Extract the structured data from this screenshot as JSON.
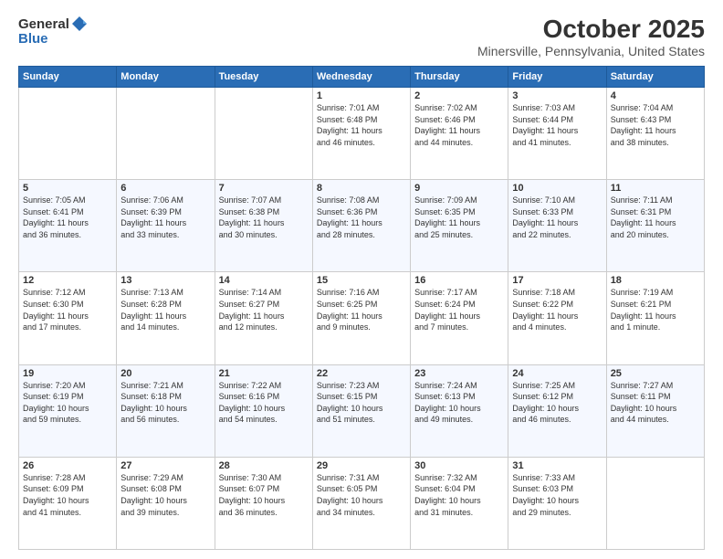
{
  "header": {
    "logo_general": "General",
    "logo_blue": "Blue",
    "title": "October 2025",
    "subtitle": "Minersville, Pennsylvania, United States"
  },
  "days_of_week": [
    "Sunday",
    "Monday",
    "Tuesday",
    "Wednesday",
    "Thursday",
    "Friday",
    "Saturday"
  ],
  "weeks": [
    [
      {
        "day": "",
        "info": ""
      },
      {
        "day": "",
        "info": ""
      },
      {
        "day": "",
        "info": ""
      },
      {
        "day": "1",
        "info": "Sunrise: 7:01 AM\nSunset: 6:48 PM\nDaylight: 11 hours\nand 46 minutes."
      },
      {
        "day": "2",
        "info": "Sunrise: 7:02 AM\nSunset: 6:46 PM\nDaylight: 11 hours\nand 44 minutes."
      },
      {
        "day": "3",
        "info": "Sunrise: 7:03 AM\nSunset: 6:44 PM\nDaylight: 11 hours\nand 41 minutes."
      },
      {
        "day": "4",
        "info": "Sunrise: 7:04 AM\nSunset: 6:43 PM\nDaylight: 11 hours\nand 38 minutes."
      }
    ],
    [
      {
        "day": "5",
        "info": "Sunrise: 7:05 AM\nSunset: 6:41 PM\nDaylight: 11 hours\nand 36 minutes."
      },
      {
        "day": "6",
        "info": "Sunrise: 7:06 AM\nSunset: 6:39 PM\nDaylight: 11 hours\nand 33 minutes."
      },
      {
        "day": "7",
        "info": "Sunrise: 7:07 AM\nSunset: 6:38 PM\nDaylight: 11 hours\nand 30 minutes."
      },
      {
        "day": "8",
        "info": "Sunrise: 7:08 AM\nSunset: 6:36 PM\nDaylight: 11 hours\nand 28 minutes."
      },
      {
        "day": "9",
        "info": "Sunrise: 7:09 AM\nSunset: 6:35 PM\nDaylight: 11 hours\nand 25 minutes."
      },
      {
        "day": "10",
        "info": "Sunrise: 7:10 AM\nSunset: 6:33 PM\nDaylight: 11 hours\nand 22 minutes."
      },
      {
        "day": "11",
        "info": "Sunrise: 7:11 AM\nSunset: 6:31 PM\nDaylight: 11 hours\nand 20 minutes."
      }
    ],
    [
      {
        "day": "12",
        "info": "Sunrise: 7:12 AM\nSunset: 6:30 PM\nDaylight: 11 hours\nand 17 minutes."
      },
      {
        "day": "13",
        "info": "Sunrise: 7:13 AM\nSunset: 6:28 PM\nDaylight: 11 hours\nand 14 minutes."
      },
      {
        "day": "14",
        "info": "Sunrise: 7:14 AM\nSunset: 6:27 PM\nDaylight: 11 hours\nand 12 minutes."
      },
      {
        "day": "15",
        "info": "Sunrise: 7:16 AM\nSunset: 6:25 PM\nDaylight: 11 hours\nand 9 minutes."
      },
      {
        "day": "16",
        "info": "Sunrise: 7:17 AM\nSunset: 6:24 PM\nDaylight: 11 hours\nand 7 minutes."
      },
      {
        "day": "17",
        "info": "Sunrise: 7:18 AM\nSunset: 6:22 PM\nDaylight: 11 hours\nand 4 minutes."
      },
      {
        "day": "18",
        "info": "Sunrise: 7:19 AM\nSunset: 6:21 PM\nDaylight: 11 hours\nand 1 minute."
      }
    ],
    [
      {
        "day": "19",
        "info": "Sunrise: 7:20 AM\nSunset: 6:19 PM\nDaylight: 10 hours\nand 59 minutes."
      },
      {
        "day": "20",
        "info": "Sunrise: 7:21 AM\nSunset: 6:18 PM\nDaylight: 10 hours\nand 56 minutes."
      },
      {
        "day": "21",
        "info": "Sunrise: 7:22 AM\nSunset: 6:16 PM\nDaylight: 10 hours\nand 54 minutes."
      },
      {
        "day": "22",
        "info": "Sunrise: 7:23 AM\nSunset: 6:15 PM\nDaylight: 10 hours\nand 51 minutes."
      },
      {
        "day": "23",
        "info": "Sunrise: 7:24 AM\nSunset: 6:13 PM\nDaylight: 10 hours\nand 49 minutes."
      },
      {
        "day": "24",
        "info": "Sunrise: 7:25 AM\nSunset: 6:12 PM\nDaylight: 10 hours\nand 46 minutes."
      },
      {
        "day": "25",
        "info": "Sunrise: 7:27 AM\nSunset: 6:11 PM\nDaylight: 10 hours\nand 44 minutes."
      }
    ],
    [
      {
        "day": "26",
        "info": "Sunrise: 7:28 AM\nSunset: 6:09 PM\nDaylight: 10 hours\nand 41 minutes."
      },
      {
        "day": "27",
        "info": "Sunrise: 7:29 AM\nSunset: 6:08 PM\nDaylight: 10 hours\nand 39 minutes."
      },
      {
        "day": "28",
        "info": "Sunrise: 7:30 AM\nSunset: 6:07 PM\nDaylight: 10 hours\nand 36 minutes."
      },
      {
        "day": "29",
        "info": "Sunrise: 7:31 AM\nSunset: 6:05 PM\nDaylight: 10 hours\nand 34 minutes."
      },
      {
        "day": "30",
        "info": "Sunrise: 7:32 AM\nSunset: 6:04 PM\nDaylight: 10 hours\nand 31 minutes."
      },
      {
        "day": "31",
        "info": "Sunrise: 7:33 AM\nSunset: 6:03 PM\nDaylight: 10 hours\nand 29 minutes."
      },
      {
        "day": "",
        "info": ""
      }
    ]
  ]
}
